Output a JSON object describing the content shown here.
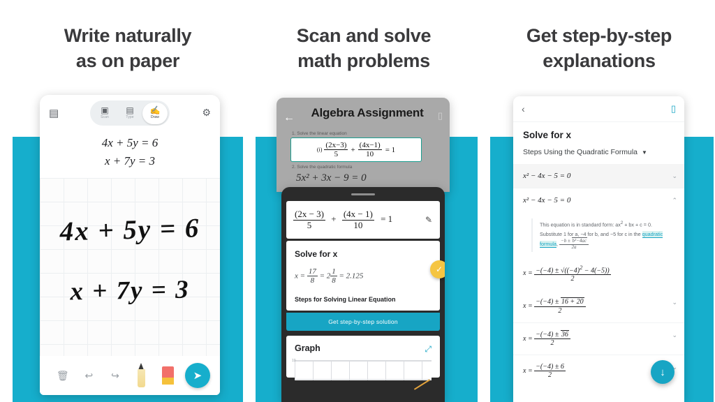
{
  "theme": {
    "teal": "#16AECC",
    "teal_dark": "#17A5C4",
    "heading_color": "#3a3a3c",
    "accent_yellow": "#f5c542"
  },
  "panels": [
    {
      "heading_line1": "Write naturally",
      "heading_line2": "as on paper",
      "app": {
        "left_icon": "library-icon",
        "right_icon": "settings-icon",
        "tabs": [
          {
            "label": "Scan",
            "icon": "camera-icon",
            "active": false
          },
          {
            "label": "Type",
            "icon": "keyboard-icon",
            "active": false
          },
          {
            "label": "Draw",
            "icon": "hand-draw-icon",
            "active": true
          }
        ],
        "typeset_equations": [
          "4x + 5y = 6",
          "x + 7y = 3"
        ],
        "handwriting": [
          "4x + 5y = 6",
          "x + 7y = 3"
        ],
        "bottom_tools": [
          {
            "name": "delete",
            "icon": "trash-icon"
          },
          {
            "name": "undo",
            "icon": "undo-icon"
          },
          {
            "name": "redo",
            "icon": "redo-icon"
          },
          {
            "name": "pencil",
            "icon": "pencil-icon"
          },
          {
            "name": "eraser",
            "icon": "eraser-icon"
          },
          {
            "name": "submit",
            "icon": "send-icon"
          }
        ]
      }
    },
    {
      "heading_line1": "Scan and solve",
      "heading_line2": "math problems",
      "scan": {
        "back_icon": "arrow-left-icon",
        "flash_icon": "flash-icon",
        "title": "Algebra Assignment",
        "problem1_label": "1. Solve the linear equation",
        "problem2_label": "2. Solve the quadratic formula",
        "highlighted_equation": "(i)  (2x−3)/5 + (4x−1)/10 = 1",
        "quadratic_equation": "5x² + 3x − 9 = 0"
      },
      "sheet": {
        "equation": "(2x − 3)/5 + (4x − 1)/10 = 1",
        "edit_icon": "pencil-edit-icon",
        "solve_title": "Solve for x",
        "answer": "x = 17/8 = 2 1/8 = 2.125",
        "check_icon": "check-icon",
        "steps_label": "Steps for Solving Linear Equation",
        "cta_label": "Get step-by-step solution",
        "graph_title": "Graph",
        "expand_icon": "expand-icon",
        "graph_y_label": "10"
      }
    },
    {
      "heading_line1": "Get step-by-step",
      "heading_line2": "explanations",
      "app": {
        "back_icon": "chevron-left-icon",
        "device_icon": "device-icon",
        "title": "Solve for x",
        "method_label": "Steps Using the Quadratic Formula",
        "method_caret": "dropdown-caret-icon",
        "steps": [
          {
            "expr": "x² − 4x − 5 = 0",
            "shaded": true,
            "chevron": "chevron-down-icon"
          },
          {
            "expr": "x² − 4x − 5 = 0",
            "shaded": false,
            "chevron": "chevron-up-icon"
          }
        ],
        "explanation": {
          "part1": "This equation is in standard form: ax",
          "sup1": "2",
          "part2": " + bx + c = 0. Substitute 1 for a, −4 for b, and −5 for c in the ",
          "link": "quadratic formula",
          "part3": ", ",
          "formula": "(−b ± √(b²−4ac)) / 2a"
        },
        "formula_steps": [
          {
            "expr": "x = ( −(−4) ± √((−4)² − 4(−5)) ) / 2",
            "chevron": ""
          },
          {
            "expr": "x = ( −(−4) ± √(16 + 20) ) / 2",
            "chevron": "chevron-down-icon"
          },
          {
            "expr": "x = ( −(−4) ± √36 ) / 2",
            "chevron": "chevron-down-icon"
          },
          {
            "expr": "x = ( −(−4) ± 6 ) / 2",
            "chevron": "chevron-down-icon"
          }
        ],
        "download_icon": "download-icon"
      }
    }
  ]
}
